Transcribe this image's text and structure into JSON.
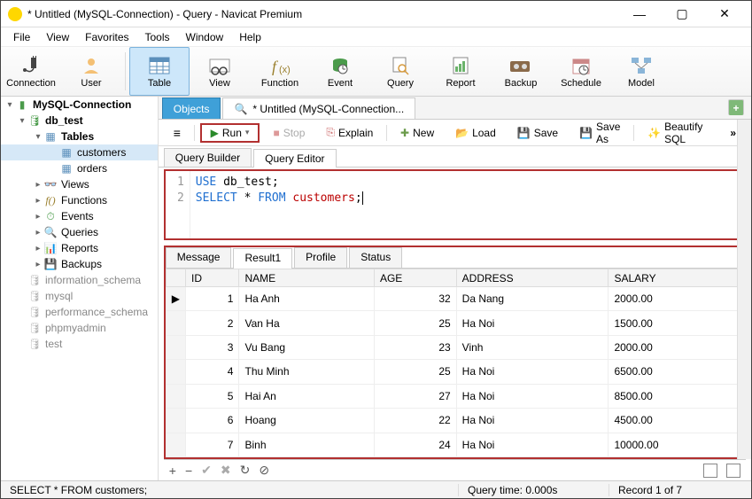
{
  "window": {
    "title": "* Untitled (MySQL-Connection) - Query - Navicat Premium"
  },
  "menu": [
    "File",
    "View",
    "Favorites",
    "Tools",
    "Window",
    "Help"
  ],
  "toolbar": [
    {
      "id": "connection",
      "label": "Connection"
    },
    {
      "id": "user",
      "label": "User"
    },
    {
      "id": "table",
      "label": "Table",
      "active": true
    },
    {
      "id": "view",
      "label": "View"
    },
    {
      "id": "function",
      "label": "Function"
    },
    {
      "id": "event",
      "label": "Event"
    },
    {
      "id": "query",
      "label": "Query"
    },
    {
      "id": "report",
      "label": "Report"
    },
    {
      "id": "backup",
      "label": "Backup"
    },
    {
      "id": "schedule",
      "label": "Schedule"
    },
    {
      "id": "model",
      "label": "Model"
    }
  ],
  "tree": {
    "conn": "MySQL-Connection",
    "db": "db_test",
    "tables_label": "Tables",
    "tables": [
      "customers",
      "orders"
    ],
    "subgroups": [
      "Views",
      "Functions",
      "Events",
      "Queries",
      "Reports",
      "Backups"
    ],
    "other_dbs": [
      "information_schema",
      "mysql",
      "performance_schema",
      "phpmyadmin",
      "test"
    ]
  },
  "maintabs": {
    "objects": "Objects",
    "query": "* Untitled (MySQL-Connection..."
  },
  "querytb": {
    "run": "Run",
    "stop": "Stop",
    "explain": "Explain",
    "new": "New",
    "load": "Load",
    "save": "Save",
    "saveas": "Save As",
    "beautify": "Beautify SQL"
  },
  "subtabs": {
    "builder": "Query Builder",
    "editor": "Query Editor"
  },
  "code": {
    "line1_kw": "USE",
    "line1_rest": " db_test;",
    "line2_kw": "SELECT",
    "line2_mid": " * ",
    "line2_from": "FROM",
    "line2_tbl": " customers",
    "line2_semi": ";"
  },
  "result_tabs": [
    "Message",
    "Result1",
    "Profile",
    "Status"
  ],
  "chart_data": {
    "type": "table",
    "columns": [
      "ID",
      "NAME",
      "AGE",
      "ADDRESS",
      "SALARY"
    ],
    "rows": [
      {
        "ID": 1,
        "NAME": "Ha Anh",
        "AGE": 32,
        "ADDRESS": "Da Nang",
        "SALARY": "2000.00"
      },
      {
        "ID": 2,
        "NAME": "Van Ha",
        "AGE": 25,
        "ADDRESS": "Ha Noi",
        "SALARY": "1500.00"
      },
      {
        "ID": 3,
        "NAME": "Vu Bang",
        "AGE": 23,
        "ADDRESS": "Vinh",
        "SALARY": "2000.00"
      },
      {
        "ID": 4,
        "NAME": "Thu Minh",
        "AGE": 25,
        "ADDRESS": "Ha Noi",
        "SALARY": "6500.00"
      },
      {
        "ID": 5,
        "NAME": "Hai An",
        "AGE": 27,
        "ADDRESS": "Ha Noi",
        "SALARY": "8500.00"
      },
      {
        "ID": 6,
        "NAME": "Hoang",
        "AGE": 22,
        "ADDRESS": "Ha Noi",
        "SALARY": "4500.00"
      },
      {
        "ID": 7,
        "NAME": "Binh",
        "AGE": 24,
        "ADDRESS": "Ha Noi",
        "SALARY": "10000.00"
      }
    ]
  },
  "status": {
    "sql": "SELECT * FROM customers;",
    "time": "Query time: 0.000s",
    "record": "Record 1 of 7"
  }
}
